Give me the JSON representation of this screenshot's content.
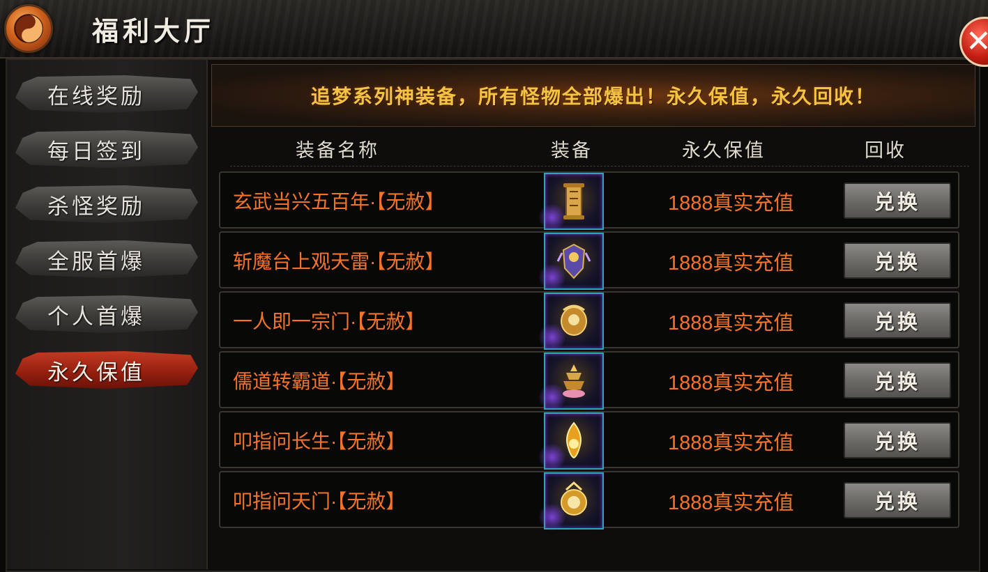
{
  "header": {
    "title": "福利大厅",
    "close_icon": "close-icon",
    "logo_icon": "taiji-icon"
  },
  "sidebar": {
    "items": [
      {
        "label": "在线奖励",
        "active": false
      },
      {
        "label": "每日签到",
        "active": false
      },
      {
        "label": "杀怪奖励",
        "active": false
      },
      {
        "label": "全服首爆",
        "active": false
      },
      {
        "label": "个人首爆",
        "active": false
      },
      {
        "label": "永久保值",
        "active": true
      }
    ]
  },
  "banner": {
    "text": "追梦系列神装备，所有怪物全部爆出！永久保值，永久回收！"
  },
  "table": {
    "headers": {
      "name": "装备名称",
      "item": "装备",
      "value": "永久保值",
      "recycle": "回收"
    },
    "rows": [
      {
        "name": "玄武当兴五百年·【无赦】",
        "value": "1888真实充值",
        "button": "兑换",
        "icon": "scroll-icon"
      },
      {
        "name": "斩魔台上观天雷·【无赦】",
        "value": "1888真实充值",
        "button": "兑换",
        "icon": "armor-icon"
      },
      {
        "name": "一人即一宗门·【无赦】",
        "value": "1888真实充值",
        "button": "兑换",
        "icon": "dragon-icon"
      },
      {
        "name": "儒道转霸道·【无赦】",
        "value": "1888真实充值",
        "button": "兑换",
        "icon": "pagoda-icon"
      },
      {
        "name": "叩指问长生·【无赦】",
        "value": "1888真实充值",
        "button": "兑换",
        "icon": "flame-icon"
      },
      {
        "name": "叩指问天门·【无赦】",
        "value": "1888真实充值",
        "button": "兑换",
        "icon": "gold-orb-icon"
      }
    ]
  },
  "colors": {
    "accent_orange": "#f3732a",
    "banner_gold": "#f4c343",
    "active_red": "#a8260f",
    "item_border": "#2fa3b8"
  }
}
